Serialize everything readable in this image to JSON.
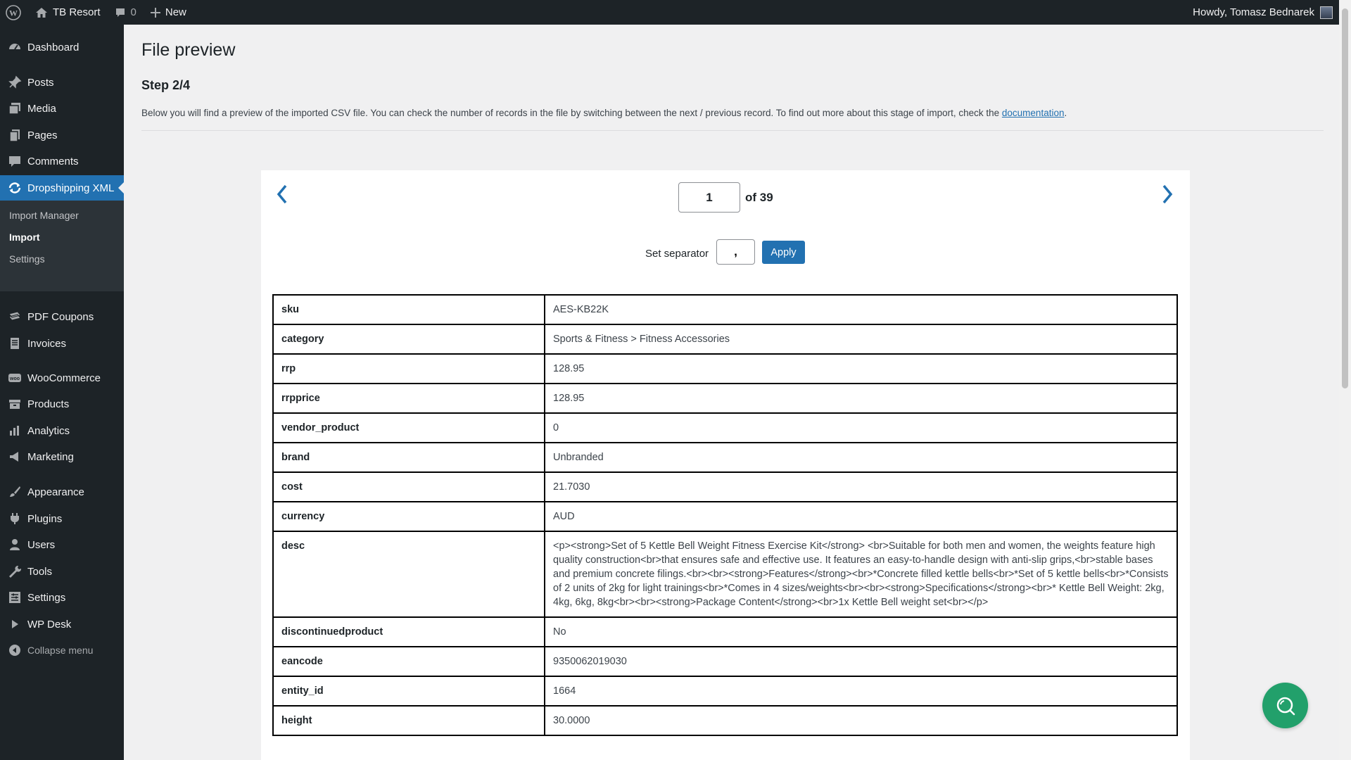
{
  "adminbar": {
    "site_name": "TB Resort",
    "comments_count": "0",
    "new_label": "New",
    "greeting": "Howdy, Tomasz Bednarek"
  },
  "sidebar": {
    "items": [
      {
        "label": "Dashboard",
        "icon": "dashboard-icon"
      },
      {
        "label": "Posts",
        "icon": "pin-icon"
      },
      {
        "label": "Media",
        "icon": "media-icon"
      },
      {
        "label": "Pages",
        "icon": "pages-icon"
      },
      {
        "label": "Comments",
        "icon": "comment-icon"
      },
      {
        "label": "Dropshipping XML",
        "icon": "sync-icon"
      },
      {
        "label": "PDF Coupons",
        "icon": "coupon-icon"
      },
      {
        "label": "Invoices",
        "icon": "invoice-icon"
      },
      {
        "label": "WooCommerce",
        "icon": "woo-icon"
      },
      {
        "label": "Products",
        "icon": "archive-icon"
      },
      {
        "label": "Analytics",
        "icon": "chart-icon"
      },
      {
        "label": "Marketing",
        "icon": "megaphone-icon"
      },
      {
        "label": "Appearance",
        "icon": "brush-icon"
      },
      {
        "label": "Plugins",
        "icon": "plugin-icon"
      },
      {
        "label": "Users",
        "icon": "user-icon"
      },
      {
        "label": "Tools",
        "icon": "wrench-icon"
      },
      {
        "label": "Settings",
        "icon": "settings-icon"
      },
      {
        "label": "WP Desk",
        "icon": "play-icon"
      }
    ],
    "submenu": [
      "Import Manager",
      "Import",
      "Settings"
    ],
    "collapse_label": "Collapse menu"
  },
  "page": {
    "title": "File preview",
    "step": "Step 2/4",
    "intro": "Below you will find a preview of the imported CSV file. You can check the number of records in the file by switching between the next / previous record. To find out more about this stage of import, check the ",
    "intro_link": "documentation",
    "intro_end": "."
  },
  "preview": {
    "current_record": "1",
    "total_label": "of 39",
    "separator_label": "Set separator",
    "separator_value": ",",
    "apply_label": "Apply",
    "rows": [
      {
        "key": "sku",
        "value": "AES-KB22K"
      },
      {
        "key": "category",
        "value": "Sports & Fitness > Fitness Accessories"
      },
      {
        "key": "rrp",
        "value": "128.95"
      },
      {
        "key": "rrpprice",
        "value": "128.95"
      },
      {
        "key": "vendor_product",
        "value": "0"
      },
      {
        "key": "brand",
        "value": "Unbranded"
      },
      {
        "key": "cost",
        "value": "21.7030"
      },
      {
        "key": "currency",
        "value": "AUD"
      },
      {
        "key": "desc",
        "value": "<p><strong>Set of 5 Kettle Bell Weight Fitness Exercise Kit</strong> <br>Suitable for both men and women, the weights feature high quality construction<br>that ensures safe and effective use. It features an easy-to-handle design with anti-slip grips,<br>stable bases and premium concrete filings.<br><br><strong>Features</strong><br>*Concrete filled kettle bells<br>*Set of 5 kettle bells<br>*Consists of 2 units of 2kg for light trainings<br>*Comes in 4 sizes/weights<br><br><strong>Specifications</strong><br>* Kettle Bell Weight: 2kg, 4kg, 6kg, 8kg<br><br><strong>Package Content</strong><br>1x Kettle Bell weight set<br></p>"
      },
      {
        "key": "discontinuedproduct",
        "value": "No"
      },
      {
        "key": "eancode",
        "value": "9350062019030"
      },
      {
        "key": "entity_id",
        "value": "1664"
      },
      {
        "key": "height",
        "value": "30.0000"
      }
    ]
  }
}
